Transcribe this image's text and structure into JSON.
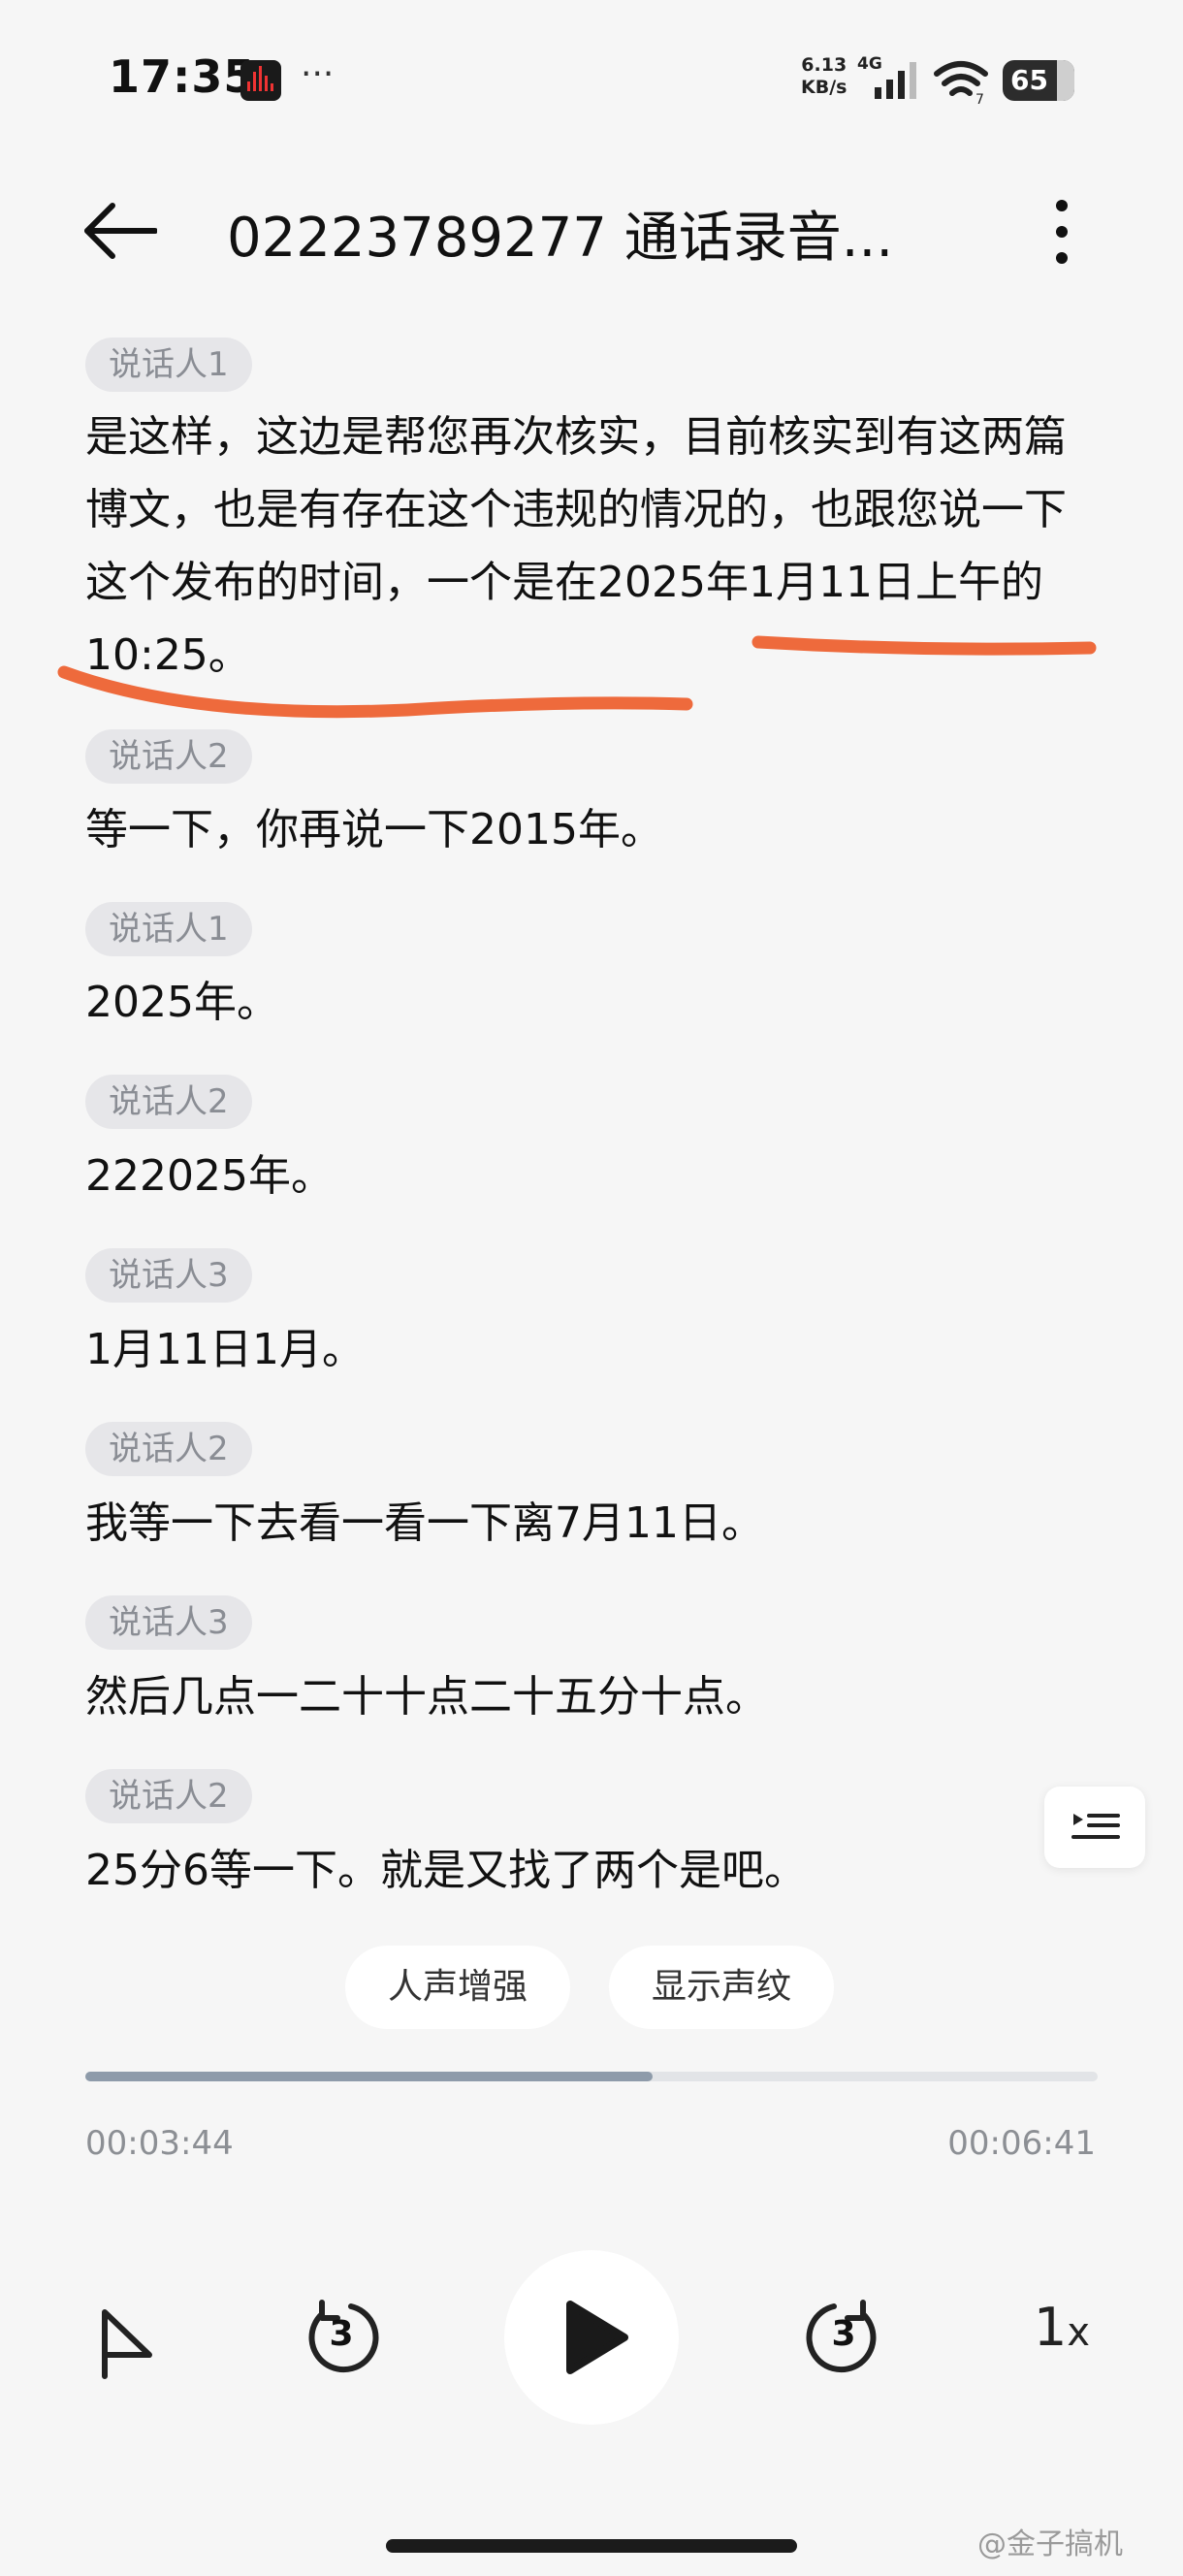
{
  "status_bar": {
    "time": "17:35",
    "net_speed_value": "6.13",
    "net_speed_unit": "KB/s",
    "network_type": "4G",
    "battery_level": "65"
  },
  "header": {
    "title": "02223789277 通话录音..."
  },
  "transcript": [
    {
      "speaker": "说话人1",
      "text": "是这样，这边是帮您再次核实，目前核实到有这两篇博文，也是有存在这个违规的情况的，也跟您说一下这个发布的时间，一个是在2025年1月11日上午的10:25。"
    },
    {
      "speaker": "说话人2",
      "text": "等一下，你再说一下2015年。"
    },
    {
      "speaker": "说话人1",
      "text": "2025年。"
    },
    {
      "speaker": "说话人2",
      "text": "222025年。"
    },
    {
      "speaker": "说话人3",
      "text": "1月11日1月。"
    },
    {
      "speaker": "说话人2",
      "text": "我等一下去看一看一下离7月11日。"
    },
    {
      "speaker": "说话人3",
      "text": "然后几点一二十十点二十五分十点。"
    },
    {
      "speaker": "说话人2",
      "text": "25分6等一下。就是又找了两个是吧。"
    }
  ],
  "actions": {
    "voice_enhance": "人声增强",
    "show_voiceprint": "显示声纹"
  },
  "player": {
    "elapsed": "00:03:44",
    "total": "00:06:41",
    "progress_fraction": 0.56,
    "skip_back_seconds": "3",
    "skip_forward_seconds": "3",
    "speed_value": "1",
    "speed_unit": "x"
  },
  "watermark": "@金子搞机",
  "colors": {
    "annotation": "#ee6a3c",
    "progress_fill": "#8e9baa",
    "chip_bg": "#e6e6e9"
  }
}
